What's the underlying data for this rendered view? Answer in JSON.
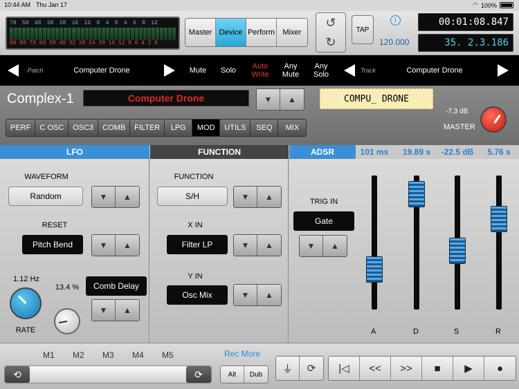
{
  "status": {
    "time": "10:44 AM",
    "date": "Thu Jan 17",
    "battery": "100%"
  },
  "meter": {
    "top_scale": [
      "78",
      "58",
      "68",
      "38",
      "28",
      "16",
      "12",
      "8",
      "4",
      "0",
      "4",
      "6",
      "8",
      "12"
    ],
    "bottom_scale": [
      "90",
      "80",
      "70",
      "60",
      "50",
      "40",
      "32",
      "28",
      "24",
      "20",
      "16",
      "12",
      "8",
      "6",
      "4",
      "2",
      "0"
    ]
  },
  "modes": [
    "Master",
    "Device",
    "Perform",
    "Mixer"
  ],
  "active_mode": "Device",
  "tap_label": "TAP",
  "bpm": "120.000",
  "time_display": "00:01:08.847",
  "bars_display": "35. 2.3.186",
  "trackbar": {
    "patch_label": "Patch",
    "patch_name": "Computer Drone",
    "mute": "Mute",
    "solo": "Solo",
    "auto_write": "Auto Write",
    "any_mute": "Any Mute",
    "any_solo": "Any Solo",
    "track_label": "Track",
    "track_name": "Computer Drone"
  },
  "instrument": {
    "name": "Complex-1",
    "patch": "Computer Drone",
    "short_name": "COMPU_ DRONE",
    "master_db": "-7.3 dB",
    "master_label": "MASTER"
  },
  "tabs": [
    "PERF",
    "C OSC",
    "OSC3",
    "COMB",
    "FILTER",
    "LPG",
    "MOD",
    "UTILS",
    "SEQ",
    "MIX"
  ],
  "active_tab": "MOD",
  "sections": {
    "lfo": "LFO",
    "function": "FUNCTION",
    "adsr": "ADSR"
  },
  "lfo": {
    "waveform_label": "WAVEFORM",
    "waveform": "Random",
    "reset_label": "RESET",
    "reset": "Pitch Bend",
    "rate_value": "1.12 Hz",
    "rate_label": "RATE",
    "mod_value": "13.4 %",
    "mod_dest": "Comb Delay"
  },
  "function": {
    "function_label": "FUNCTION",
    "function": "S/H",
    "xin_label": "X IN",
    "xin": "Filter LP",
    "yin_label": "Y IN",
    "yin": "Osc Mix"
  },
  "adsr": {
    "trig_label": "TRIG IN",
    "trig": "Gate",
    "values": [
      "101 ms",
      "19.89 s",
      "-22.5 dB",
      "5.76 s"
    ],
    "labels": [
      "A",
      "D",
      "S",
      "R"
    ],
    "levels": [
      0.25,
      0.95,
      0.42,
      0.72
    ]
  },
  "bottom": {
    "markers": [
      "M1",
      "M2",
      "M3",
      "M4",
      "M5"
    ],
    "rec_more": "Rec More",
    "alt": "Alt",
    "dub": "Dub"
  },
  "colors": {
    "accent": "#2aa8d8",
    "red": "#e02b20",
    "value_blue": "#2a7fcf"
  }
}
